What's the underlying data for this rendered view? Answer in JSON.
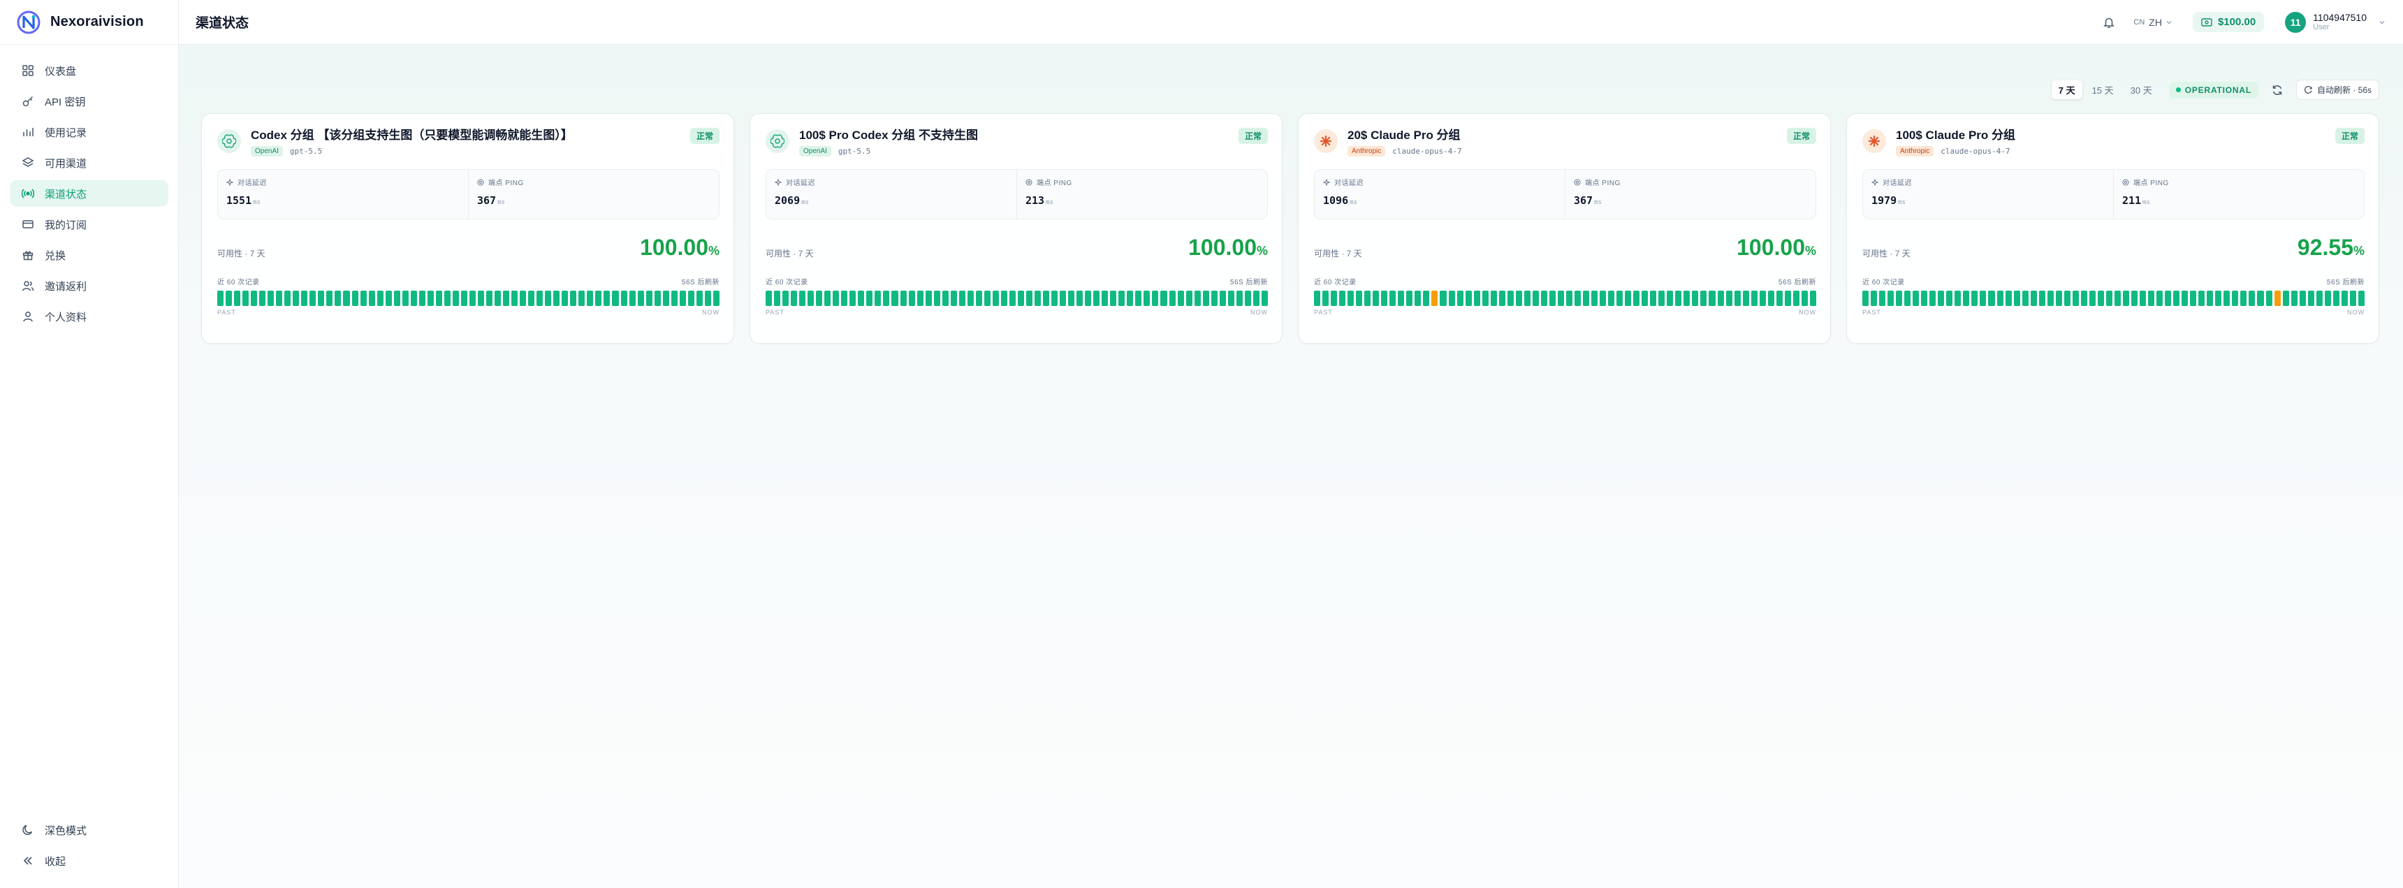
{
  "app": {
    "name": "Nexoraivision"
  },
  "sidebar": {
    "items": [
      {
        "label": "仪表盘",
        "icon": "dashboard-icon"
      },
      {
        "label": "API 密钥",
        "icon": "key-icon"
      },
      {
        "label": "使用记录",
        "icon": "chart-icon"
      },
      {
        "label": "可用渠道",
        "icon": "layers-icon"
      },
      {
        "label": "渠道状态",
        "icon": "radio-icon",
        "active": true
      },
      {
        "label": "我的订阅",
        "icon": "card-icon"
      },
      {
        "label": "兑换",
        "icon": "gift-icon"
      },
      {
        "label": "邀请返利",
        "icon": "users-icon"
      },
      {
        "label": "个人资料",
        "icon": "user-icon"
      }
    ],
    "dark_mode_label": "深色模式",
    "collapse_label": "收起"
  },
  "header": {
    "title": "渠道状态",
    "lang_prefix": "CN",
    "lang": "ZH",
    "balance": "$100.00",
    "user_initials": "11",
    "user_name": "1104947510",
    "user_role": "User"
  },
  "toolbar": {
    "ranges": [
      "7 天",
      "15 天",
      "30 天"
    ],
    "active_range": "7 天",
    "operational": "OPERATIONAL",
    "auto_refresh": "自动刷新 · 56s"
  },
  "labels": {
    "latency": "对话延迟",
    "ping": "端点 PING",
    "unit": "ms",
    "avail_prefix": "可用性 · 7 天",
    "history": "近 60 次记录",
    "interval": "56S 后刷新",
    "past": "PAST",
    "now": "NOW"
  },
  "colors": {
    "accent": "#10b981",
    "warn": "#f59e0b",
    "available": "#16a34a"
  },
  "cards": [
    {
      "title": "Codex 分组 【该分组支持生图（只要模型能调畅就能生图）】",
      "provider": "openai",
      "vendor": "OpenAI",
      "model": "gpt-5.5",
      "status": "正常",
      "latency": "1551",
      "ping": "367",
      "availability": "100.00",
      "history_warn_indices": []
    },
    {
      "title": "100$ Pro Codex 分组 不支持生图",
      "provider": "openai",
      "vendor": "OpenAI",
      "model": "gpt-5.5",
      "status": "正常",
      "latency": "2069",
      "ping": "213",
      "availability": "100.00",
      "history_warn_indices": []
    },
    {
      "title": "20$ Claude Pro 分组",
      "provider": "anthropic",
      "vendor": "Anthropic",
      "model": "claude-opus-4-7",
      "status": "正常",
      "latency": "1096",
      "ping": "367",
      "availability": "100.00",
      "history_warn_indices": [
        14
      ]
    },
    {
      "title": "100$ Claude Pro 分组",
      "provider": "anthropic",
      "vendor": "Anthropic",
      "model": "claude-opus-4-7",
      "status": "正常",
      "latency": "1979",
      "ping": "211",
      "availability": "92.55",
      "history_warn_indices": [
        49
      ]
    }
  ]
}
